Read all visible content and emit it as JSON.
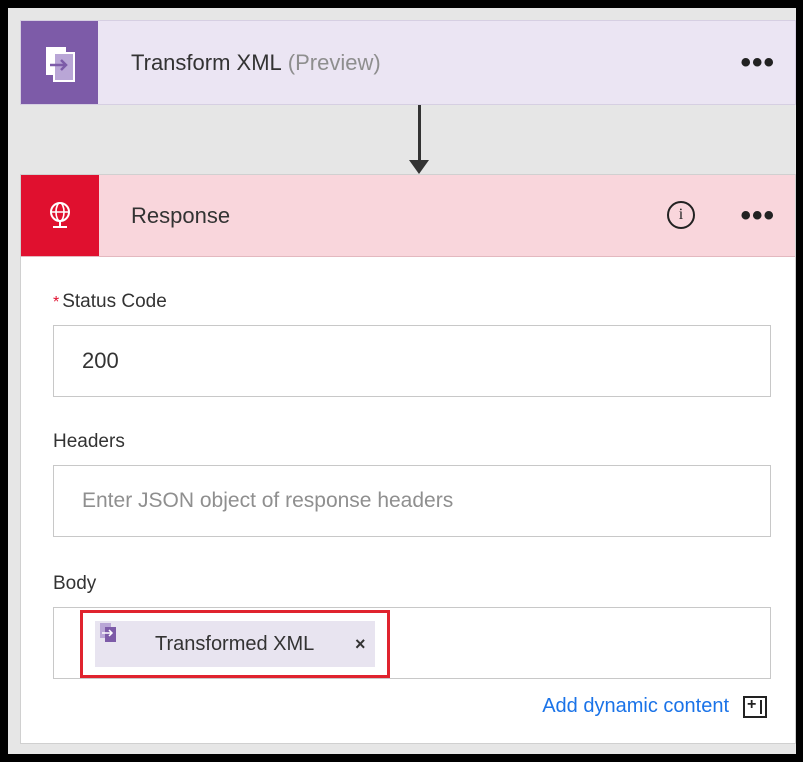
{
  "transform_card": {
    "title": "Transform XML",
    "subtitle": "(Preview)",
    "menu": "•••",
    "icon": "transform-xml-icon",
    "color": "#7d5ba8"
  },
  "response_card": {
    "title": "Response",
    "info": "i",
    "menu": "•••",
    "icon": "globe-response-icon",
    "color": "#e0102f",
    "fields": {
      "status_code": {
        "required_mark": "*",
        "label": "Status Code",
        "value": "200"
      },
      "headers": {
        "label": "Headers",
        "placeholder": "Enter JSON object of response headers"
      },
      "body": {
        "label": "Body",
        "token_label": "Transformed XML",
        "token_close": "×"
      }
    },
    "add_dynamic_content": "Add dynamic content"
  }
}
